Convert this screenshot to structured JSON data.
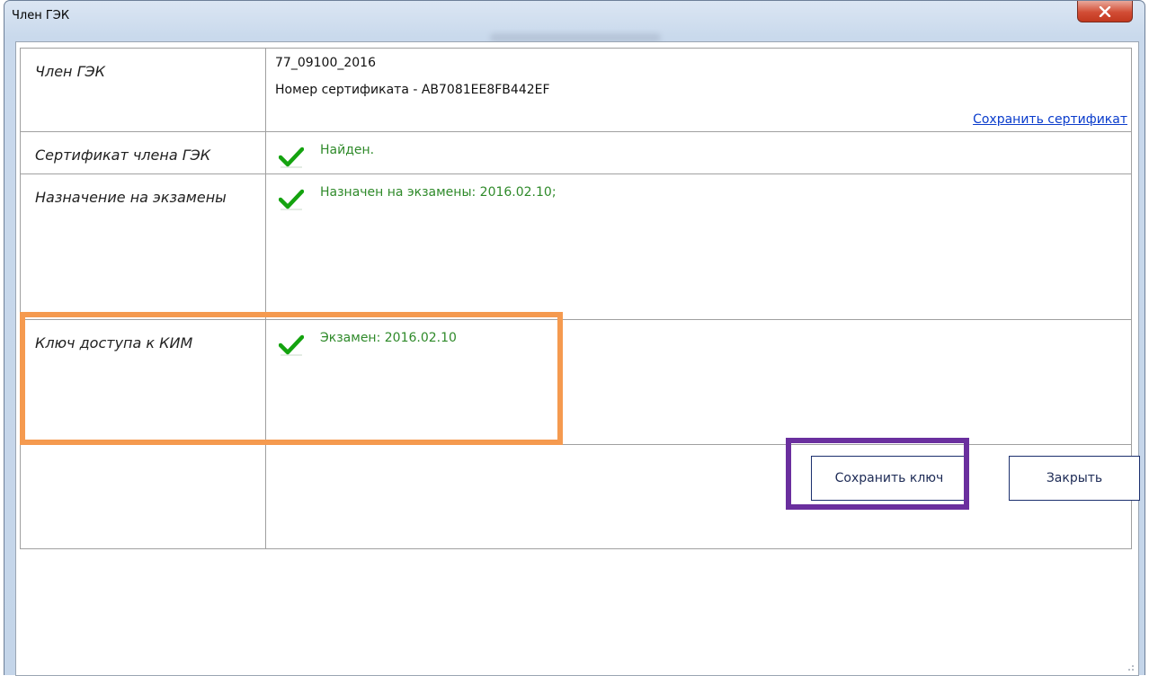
{
  "window": {
    "title": "Член ГЭК"
  },
  "rows": {
    "member": {
      "label": "Член ГЭК",
      "id": "77_09100_2016",
      "certificate_number": "Номер сертификата - AB7081EE8FB442EF",
      "save_certificate_link": "Сохранить сертификат"
    },
    "certificate": {
      "label": "Сертификат члена ГЭК",
      "status": "Найден."
    },
    "assignment": {
      "label": "Назначение на экзамены",
      "status": "Назначен на экзамены: 2016.02.10;"
    },
    "key": {
      "label": "Ключ доступа к КИМ",
      "status": "Экзамен: 2016.02.10"
    }
  },
  "buttons": {
    "save_key": "Сохранить ключ",
    "close": "Закрыть"
  },
  "colors": {
    "status_ok": "#2f8a2a",
    "highlight_orange": "#f59a4f",
    "highlight_purple": "#6a2f9e",
    "link": "#0a3ccc"
  },
  "icons": {
    "status": "check-icon",
    "window_close": "close-icon"
  }
}
